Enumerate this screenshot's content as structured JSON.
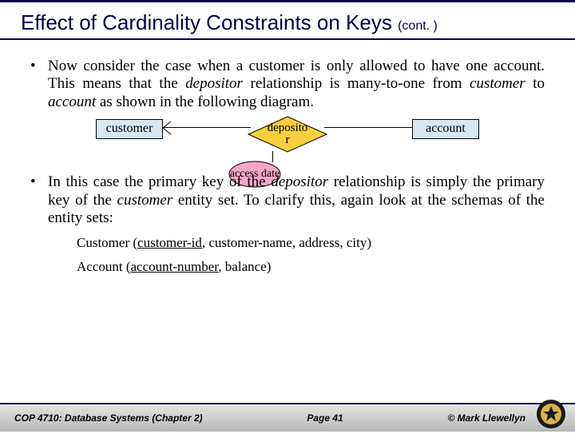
{
  "title": {
    "main": "Effect of Cardinality Constraints on Keys",
    "cont": "(cont. )"
  },
  "bullets": {
    "b1_pre": "Now consider the case when a customer is only allowed to have one account.  This means that the ",
    "b1_i1": "depositor",
    "b1_mid1": " relationship is many-to-one from ",
    "b1_i2": "customer",
    "b1_mid2": " to ",
    "b1_i3": "account",
    "b1_post": " as shown in the following diagram.",
    "b2_pre": "In this case the primary key of the ",
    "b2_i1": "depositor",
    "b2_mid1": " relationship is simply the primary key of the ",
    "b2_i2": "customer",
    "b2_post": " entity set.  To clarify this, again look at the schemas of the entity sets:"
  },
  "diagram": {
    "customer": "customer",
    "depositor": "deposito\nr",
    "account": "account",
    "attr": "access date"
  },
  "schemas": {
    "cust_label": "Customer (",
    "cust_key": "customer-id",
    "cust_rest": ", customer-name, address, city)",
    "acct_label": "Account (",
    "acct_key": "account-number",
    "acct_rest": ", balance)"
  },
  "footer": {
    "left": "COP 4710: Database Systems  (Chapter 2)",
    "mid": "Page 41",
    "right": "© Mark Llewellyn"
  }
}
